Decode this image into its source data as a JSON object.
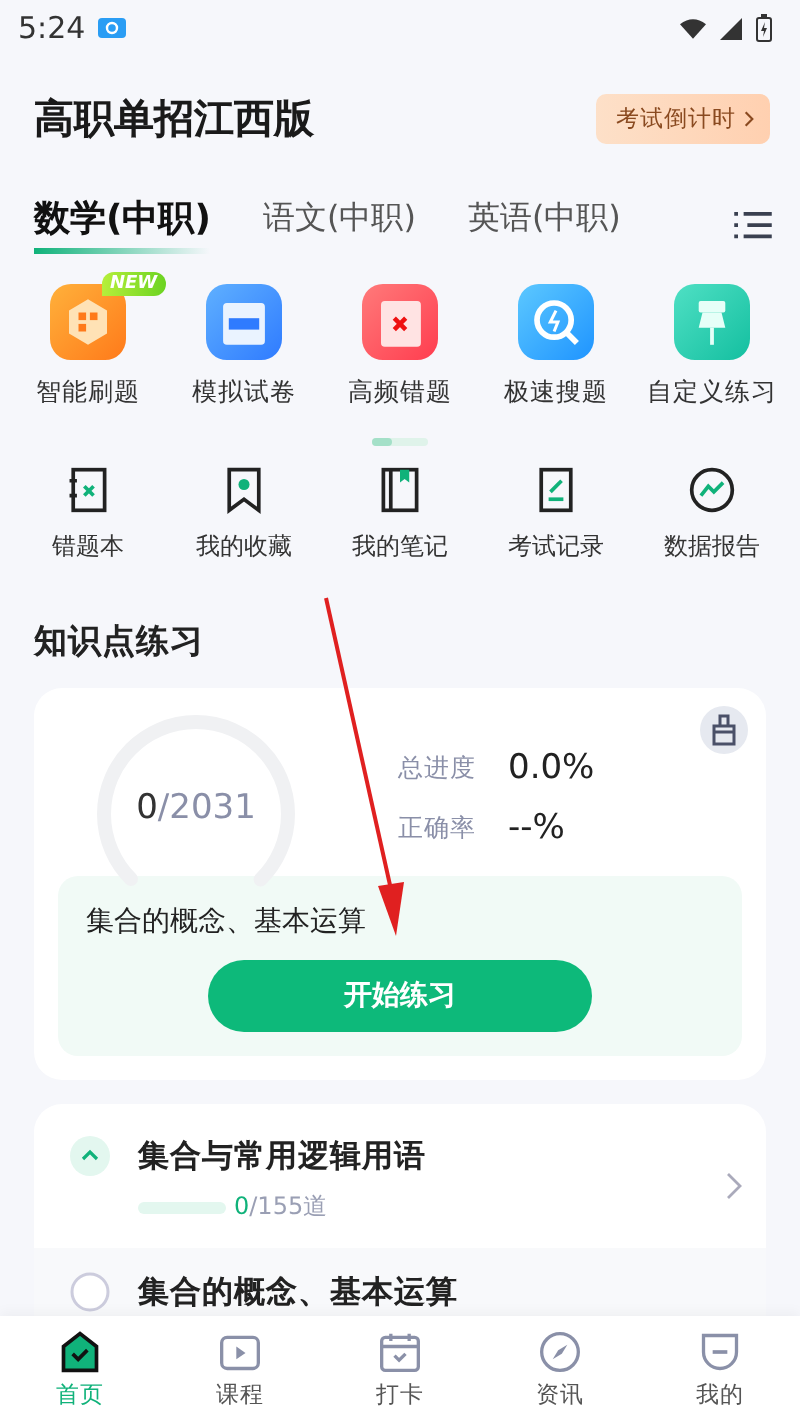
{
  "status_bar": {
    "time": "5:24"
  },
  "header": {
    "title": "高职单招江西版",
    "countdown_button": "考试倒计时"
  },
  "tabs": [
    {
      "label": "数学(中职)",
      "selected": true
    },
    {
      "label": "语文(中职)",
      "selected": false
    },
    {
      "label": "英语(中职)",
      "selected": false
    }
  ],
  "features": [
    {
      "label": "智能刷题",
      "badge": "NEW"
    },
    {
      "label": "模拟试卷"
    },
    {
      "label": "高频错题"
    },
    {
      "label": "极速搜题"
    },
    {
      "label": "自定义练习"
    }
  ],
  "tools": [
    "错题本",
    "我的收藏",
    "我的笔记",
    "考试记录",
    "数据报告"
  ],
  "section_title": "知识点练习",
  "progress_card": {
    "done": "0",
    "total": "/2031",
    "stats": [
      {
        "label": "总进度",
        "value": "0.0%"
      },
      {
        "label": "正确率",
        "value": "--%"
      }
    ],
    "current_topic": "集合的概念、基本运算",
    "start_button": "开始练习"
  },
  "chapters": [
    {
      "title": "集合与常用逻辑用语",
      "expanded": true,
      "level": 0,
      "done": "0",
      "total": "/155道"
    },
    {
      "title": "集合的概念、基本运算",
      "expanded": false
    }
  ],
  "nav": [
    {
      "label": "首页",
      "selected": true
    },
    {
      "label": "课程",
      "selected": false
    },
    {
      "label": "打卡",
      "selected": false
    },
    {
      "label": "资讯",
      "selected": false
    },
    {
      "label": "我的",
      "selected": false
    }
  ]
}
